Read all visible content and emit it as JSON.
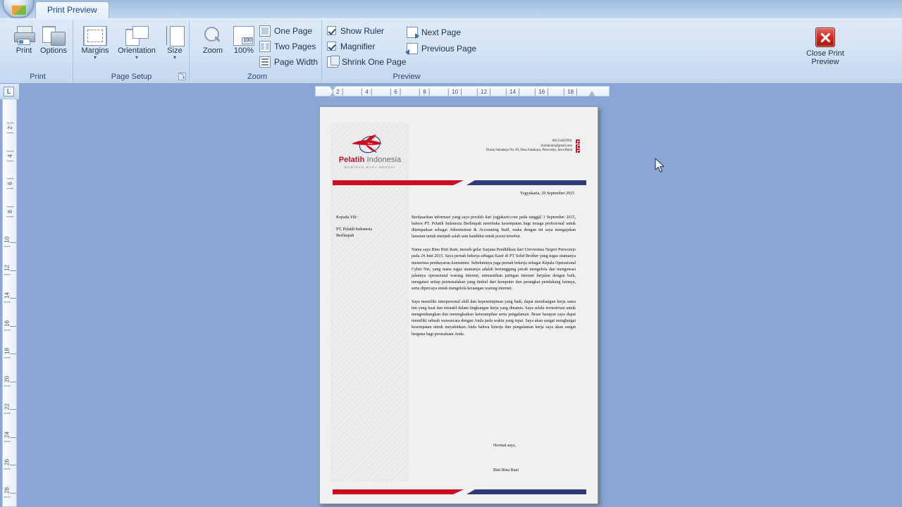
{
  "window": {
    "tab_label": "Print Preview",
    "office_button": "office-orb"
  },
  "ribbon": {
    "groups": [
      {
        "name": "Print",
        "label": "Print",
        "buttons": [
          {
            "label": "Print",
            "icon": "printer-icon"
          },
          {
            "label": "Options",
            "icon": "options-icon"
          }
        ]
      },
      {
        "name": "Page Setup",
        "label": "Page Setup",
        "buttons": [
          {
            "label": "Margins",
            "icon": "margins-icon",
            "caret": "▾"
          },
          {
            "label": "Orientation",
            "icon": "orientation-icon",
            "caret": "▾"
          },
          {
            "label": "Size",
            "icon": "size-icon",
            "caret": "▾"
          }
        ],
        "dialog_launcher": "⤵"
      },
      {
        "name": "Zoom",
        "label": "Zoom",
        "buttons": [
          {
            "label": "Zoom",
            "icon": "magnifier-icon"
          },
          {
            "label": "100%",
            "icon": "zoom-100-icon"
          }
        ],
        "small_buttons": [
          {
            "label": "One Page",
            "icon": "one-page-icon"
          },
          {
            "label": "Two Pages",
            "icon": "two-pages-icon"
          },
          {
            "label": "Page Width",
            "icon": "page-width-icon"
          }
        ]
      },
      {
        "name": "Preview",
        "label": "Preview",
        "checkboxes": [
          {
            "label": "Show Ruler",
            "checked": true
          },
          {
            "label": "Magnifier",
            "checked": true
          }
        ],
        "small_buttons": [
          {
            "label": "Shrink One Page",
            "icon": "shrink-one-page-icon"
          },
          {
            "label": "Next Page",
            "icon": "next-page-icon"
          },
          {
            "label": "Previous Page",
            "icon": "previous-page-icon"
          }
        ],
        "close_button": {
          "label_line1": "Close Print",
          "label_line2": "Preview",
          "icon": "close-x-icon"
        }
      }
    ]
  },
  "rulers": {
    "corner_marker": "L",
    "horizontal_ticks": [
      "2",
      "4",
      "6",
      "8",
      "10",
      "12",
      "14",
      "16",
      "18"
    ],
    "vertical_ticks": [
      "2",
      "4",
      "6",
      "8",
      "10",
      "12",
      "14",
      "16",
      "18",
      "20",
      "22",
      "24",
      "26",
      "28"
    ]
  },
  "document": {
    "letterhead": {
      "logo_name_bold": "Pelatih",
      "logo_name_light": " Indonesia",
      "logo_tagline": "WARISAN BAGI NEGERI",
      "contact_phone": "081234567891",
      "contact_email": "rinirinirani@gmail.com",
      "contact_address": "Dusun Sukamaju No. 69, Desa Sukakaya, Purworejo, Jawa Barat",
      "bar_red": "#cc0d22",
      "bar_blue": "#313a78"
    },
    "date_line": "Yogyakarta, 20 September 2015",
    "addressee": {
      "salutation": "Kepada Yth :",
      "line1": "PT. Pelatih Indonesia",
      "line2": "Berlimpah"
    },
    "paragraphs": [
      "Berdasarkan informasi yang saya peroleh dari jogjakarir.com pada tanggal 3 September 2015, bahwa PT. Pelatih Indonesia Berlimpah membuka kesempatan bagi tenaga profesional untuk ditempatkan sebagai Administrasi & Accounting Staff, maka dengan ini saya mengajukan lamaran untuk menjadi salah satu kandidat untuk posisi tersebut.",
      "Nama saya Rina Rini Rani, meraih gelar Sarjana Pendidikan dari Universitas Negeri Purworejo pada 24 Juni 2015. Saya pernah bekerja sebagai Kasir di PT Solid Brother yang tugas utamanya menerima pembayaran konsumen. Sebelumnya juga pernah bekerja sebagai Kepala Operasional Cyber Net, yang mana tugas utamanya adalah bertanggung jawab mengelola dan mengawasi jalannya operasional warung internet, memastikan jaringan internet berjalan dengan baik, mengatasi setiap permasalahan yang timbul dari komputer dan perangkat pendukung lainnya, serta dipercaya untuk mengelola keuangan warung internet.",
      "Saya memiliki interpersonal skill dan kepemimpinan yang baik, dapat membangun kerja sama tim yang kuat dan inisiatif dalam lingkungan kerja yang dinamis. Saya selalu termotivasi untuk mengembangkan dan meningkatkan keterampilan serta pengalaman. Besar harapan saya dapat memiliki sebuah wawancara dengan Anda pada waktu yang tepat. Saya akan sangat menghargai kesempatan untuk meyakinkan Anda bahwa kinerja dan pengalaman kerja saya akan sangat berguna bagi perusahaan Anda."
    ],
    "closing": {
      "salutation": "Hormat saya,",
      "signer": "Rini Rina Rani"
    }
  }
}
